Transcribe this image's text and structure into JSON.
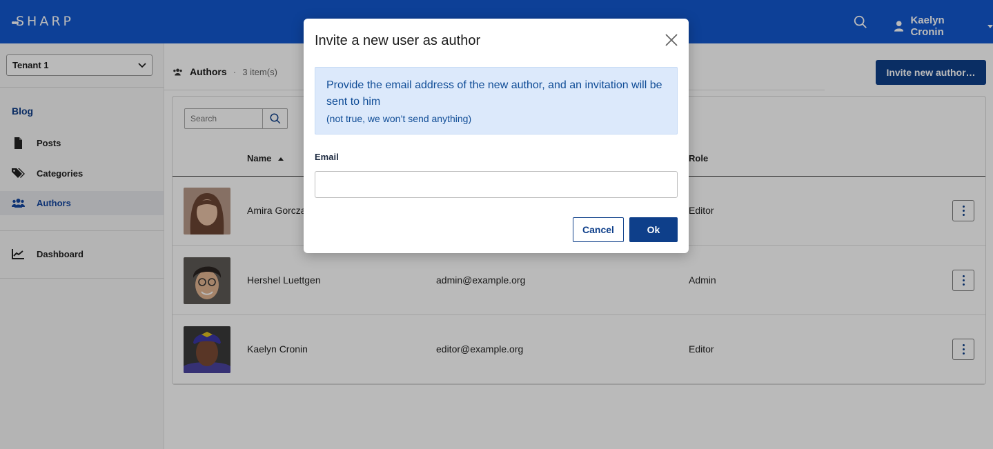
{
  "app": {
    "logo_text": "SHARP",
    "brand_color": "#1358cf",
    "accent_color": "#0e3f8a"
  },
  "header": {
    "user_name": "Kaelyn Cronin"
  },
  "sidebar": {
    "tenant_select": "Tenant 1",
    "group_title": "Blog",
    "items": [
      {
        "label": "Posts",
        "icon": "file-icon"
      },
      {
        "label": "Categories",
        "icon": "tags-icon"
      },
      {
        "label": "Authors",
        "icon": "users-icon",
        "active": true
      },
      {
        "label": "Dashboard",
        "icon": "chart-line-icon"
      }
    ]
  },
  "main": {
    "title": "Authors",
    "count": "3 item(s)",
    "invite_button": "Invite new author…",
    "search_placeholder": "Search",
    "columns": {
      "name": "Name",
      "role": "Role"
    },
    "rows": [
      {
        "name": "Amira Gorcza",
        "email": "",
        "role": "Editor"
      },
      {
        "name": "Hershel Luettgen",
        "email": "admin@example.org",
        "role": "Admin"
      },
      {
        "name": "Kaelyn Cronin",
        "email": "editor@example.org",
        "role": "Editor"
      }
    ]
  },
  "modal": {
    "title": "Invite a new user as author",
    "alert_text": "Provide the email address of the new author, and an invitation will be sent to him",
    "alert_subtext": "(not true, we won’t send anything)",
    "email_label": "Email",
    "email_value": "",
    "cancel_label": "Cancel",
    "ok_label": "Ok"
  }
}
